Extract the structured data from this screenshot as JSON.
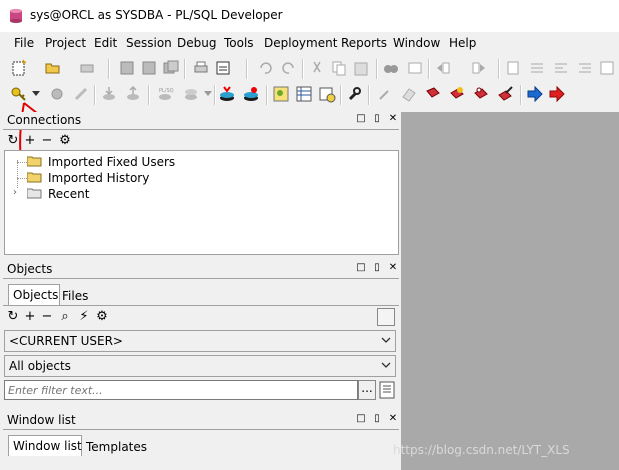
{
  "window": {
    "title": "sys@ORCL as SYSDBA - PL/SQL Developer"
  },
  "menu": [
    "File",
    "Project",
    "Edit",
    "Session",
    "Debug",
    "Tools",
    "Deployment",
    "Reports",
    "Window",
    "Help"
  ],
  "connections": {
    "title": "Connections",
    "items": [
      "Imported Fixed Users",
      "Imported History",
      "Recent"
    ]
  },
  "objects": {
    "title": "Objects",
    "tabs": [
      "Objects",
      "Files"
    ],
    "user_select": "<CURRENT USER>",
    "type_select": "All objects",
    "filter_placeholder": "Enter filter text...",
    "more_button": "..."
  },
  "window_list": {
    "title": "Window list",
    "tabs": [
      "Window list",
      "Templates"
    ]
  },
  "watermark": "https://blog.csdn.net/LYT_XLS",
  "colors": {
    "annotation_red": "#e00000",
    "right_pane": "#a9a9a9"
  }
}
